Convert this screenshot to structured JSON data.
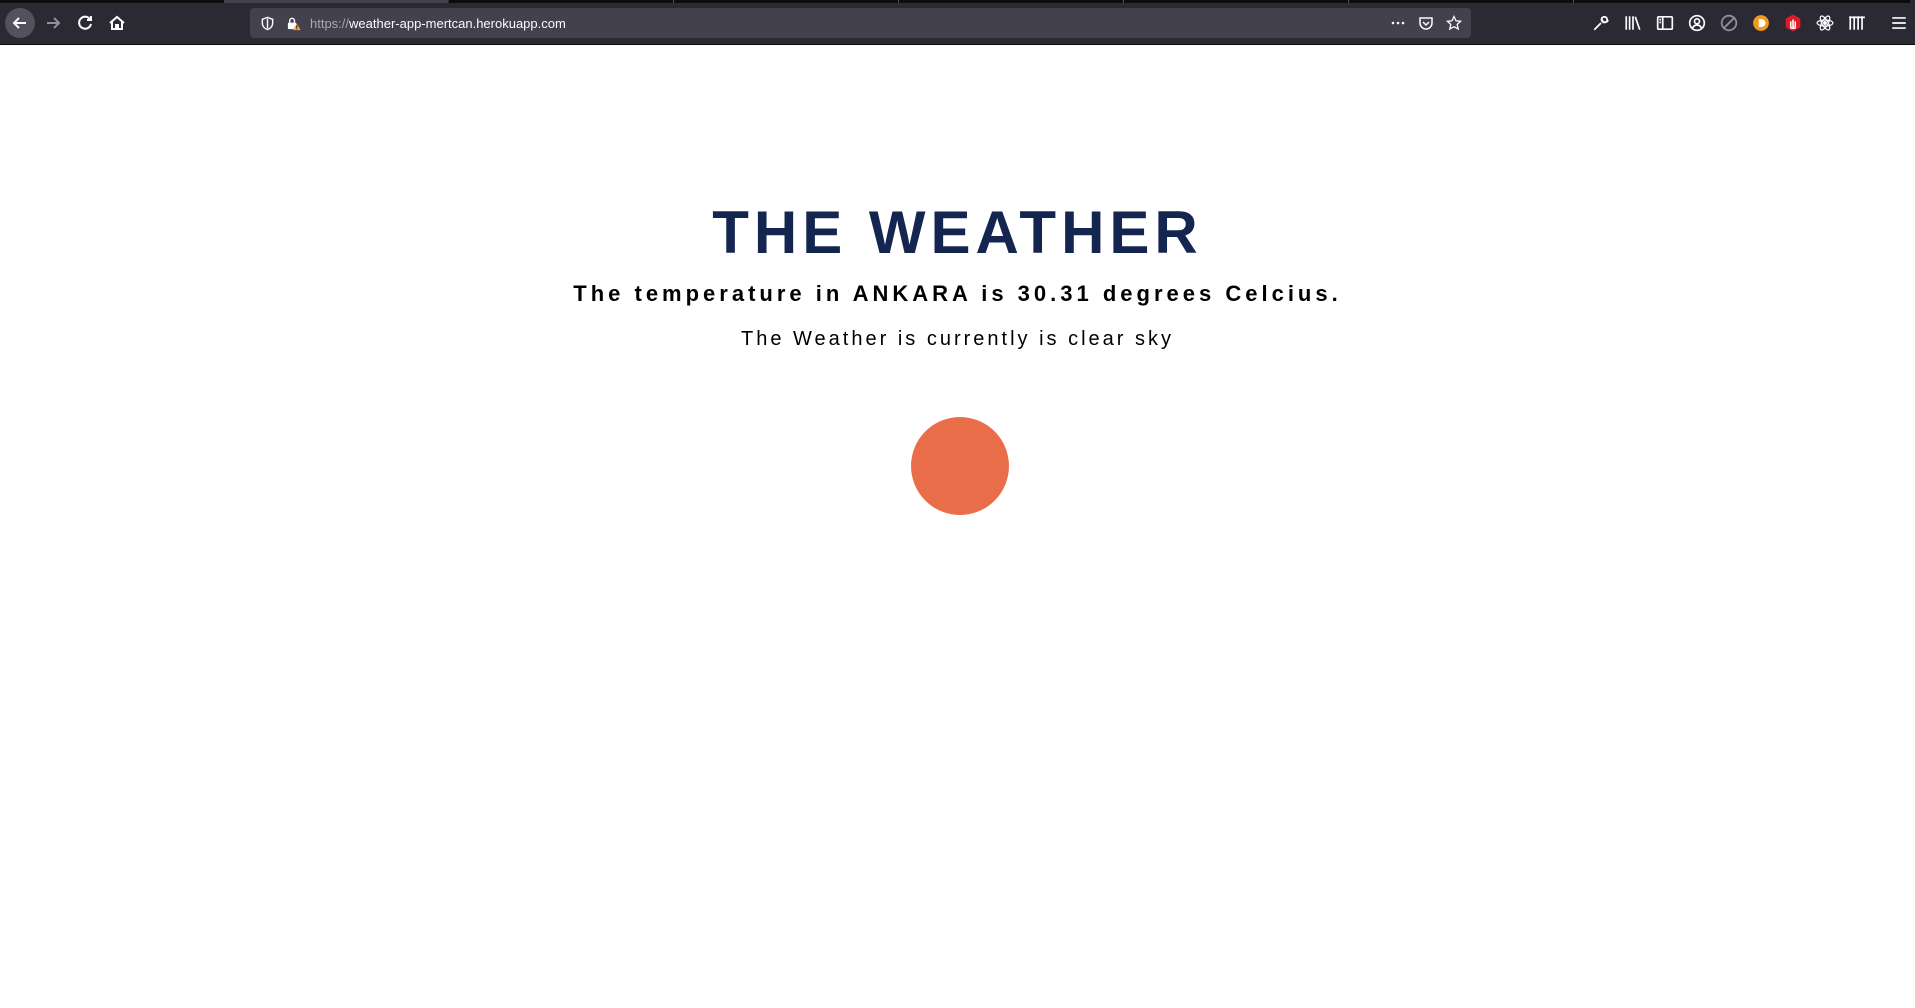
{
  "browser": {
    "url_scheme": "https://",
    "url_host": "weather-app-mertcan.herokuapp.com",
    "chrome_color": "#2b2a33",
    "urlbar_color": "#42414d"
  },
  "page": {
    "title": "THE WEATHER",
    "temperature_text": "The temperature in ANKARA is 30.31 degrees Celcius.",
    "conditions_text": "The Weather is currently is clear sky",
    "title_color": "#14264f",
    "sun_color": "#ea6d4a"
  },
  "icons": {
    "back": "arrow-left-icon",
    "forward": "arrow-right-icon",
    "reload": "reload-icon",
    "home": "home-icon",
    "shield": "shield-icon",
    "lock": "lock-warning-icon",
    "more": "ellipsis-icon",
    "pocket": "pocket-icon",
    "bookmark": "star-icon",
    "tools": "wrench-icon",
    "library": "library-icon",
    "sidebar": "sidebar-icon",
    "account": "account-icon",
    "extension_grey": "blocked-circle-icon",
    "extension_orange": "orange-extension-icon",
    "extension_red": "red-hand-icon",
    "extension_react": "react-atom-icon",
    "extension_columns": "columns-icon",
    "menu": "hamburger-menu-icon"
  }
}
